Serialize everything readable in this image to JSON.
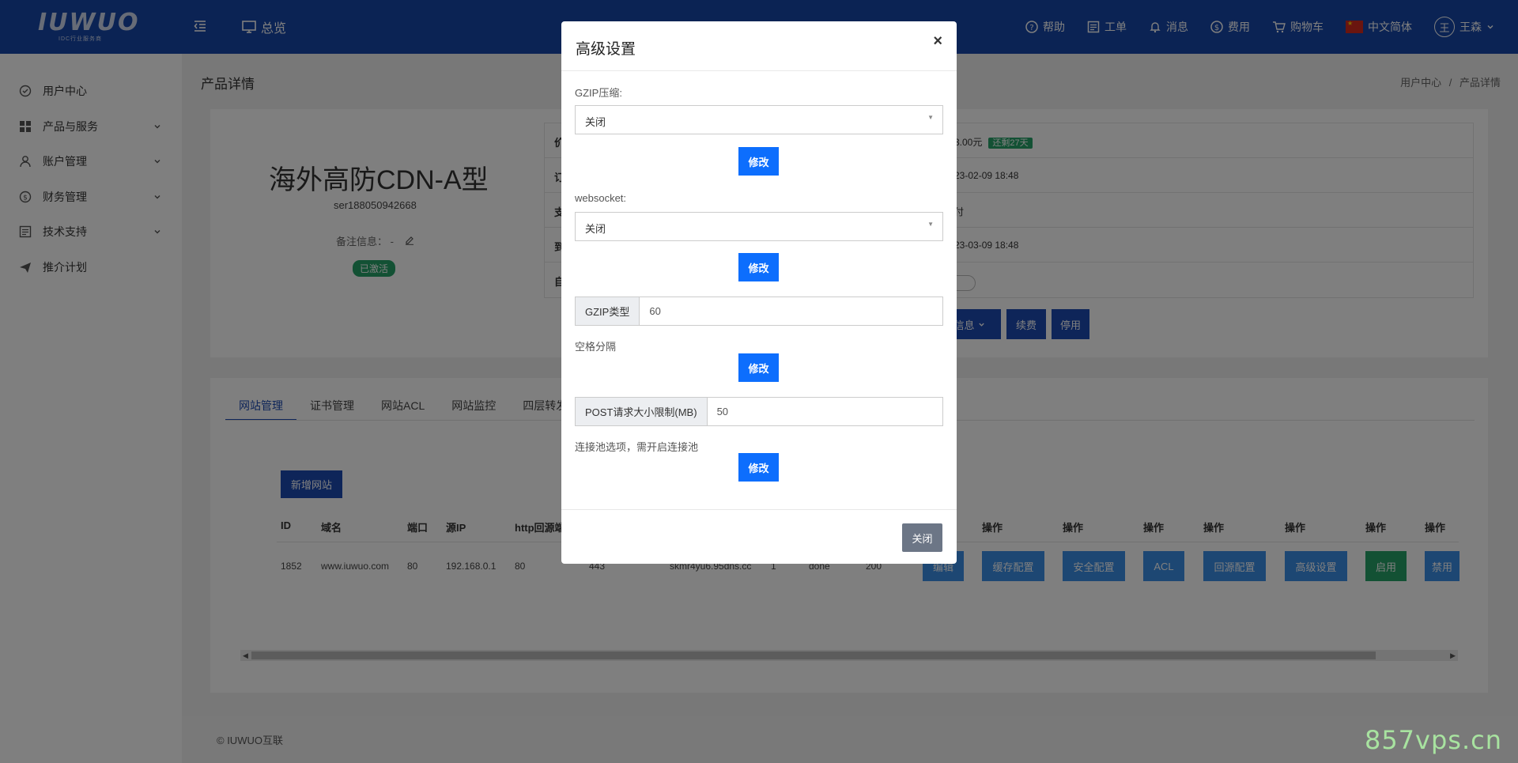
{
  "header": {
    "logo_text": "IUWUO",
    "logo_sub": "IDC行业服务商",
    "overview_label": "总览",
    "nav": [
      {
        "icon": "help-icon",
        "label": "帮助"
      },
      {
        "icon": "ticket-icon",
        "label": "工单"
      },
      {
        "icon": "bell-icon",
        "label": "消息"
      },
      {
        "icon": "dollar-icon",
        "label": "费用"
      },
      {
        "icon": "cart-icon",
        "label": "购物车"
      },
      {
        "icon": "flag-icon",
        "label": "中文简体"
      }
    ],
    "user_avatar": "王",
    "user_name": "王森"
  },
  "sidebar": {
    "items": [
      {
        "icon": "user-center-icon",
        "label": "用户中心"
      },
      {
        "icon": "grid-icon",
        "label": "产品与服务"
      },
      {
        "icon": "user-icon",
        "label": "账户管理"
      },
      {
        "icon": "finance-icon",
        "label": "财务管理"
      },
      {
        "icon": "support-icon",
        "label": "技术支持"
      },
      {
        "icon": "send-icon",
        "label": "推介计划"
      }
    ]
  },
  "page": {
    "title": "产品详情",
    "breadcrumb": [
      "用户中心",
      "/",
      "产品详情"
    ]
  },
  "product": {
    "name": "海外高防CDN-A型",
    "code": "ser188050942668",
    "remark": "备注信息： -",
    "status": "已激活",
    "info_rows": [
      {
        "label": "价",
        "value": "3.00元",
        "badge": "还剩27天"
      },
      {
        "label": "订",
        "value": "23-02-09 18:48"
      },
      {
        "label": "支",
        "value": "付"
      },
      {
        "label": "到",
        "value": "23-03-09 18:48"
      },
      {
        "label": "自",
        "value": ""
      }
    ],
    "actions": {
      "info": "信息",
      "renew": "续费",
      "stop": "停用"
    }
  },
  "tabs": [
    "网站管理",
    "证书管理",
    "网站ACL",
    "网站监控",
    "四层转发"
  ],
  "site_table": {
    "new_button": "新增网站",
    "headers": [
      "ID",
      "域名",
      "端口",
      "源IP",
      "http回源端",
      "操作",
      "操作",
      "操作",
      "操作",
      "操作",
      "操作",
      "操作"
    ],
    "row": [
      "1852",
      "www.iuwuo.com",
      "80",
      "192.168.0.1",
      "80",
      "443",
      "skmr4yu6.95dns.cc",
      "1",
      "done",
      "200"
    ],
    "row_buttons": [
      "编辑",
      "缓存配置",
      "安全配置",
      "ACL",
      "回源配置",
      "高级设置",
      "启用",
      "禁用"
    ]
  },
  "footer": {
    "copyright": "© IUWUO互联"
  },
  "watermark": "857vps.cn",
  "modal": {
    "title": "高级设置",
    "close_x": "×",
    "gzip_label": "GZIP压缩:",
    "gzip_value": "关闭",
    "websocket_label": "websocket:",
    "websocket_value": "关闭",
    "modify_label": "修改",
    "gzip_type_addon": "GZIP类型",
    "gzip_type_value": "60",
    "gzip_type_hint": "空格分隔",
    "post_limit_addon": "POST请求大小限制(MB)",
    "post_limit_value": "50",
    "pool_hint": "连接池选项，需开启连接池",
    "close_button": "关闭"
  },
  "colors": {
    "header_bg": "#1746a8",
    "primary_button": "#0d6efd",
    "success": "#26a269",
    "table_button": "#3a8ee6"
  }
}
